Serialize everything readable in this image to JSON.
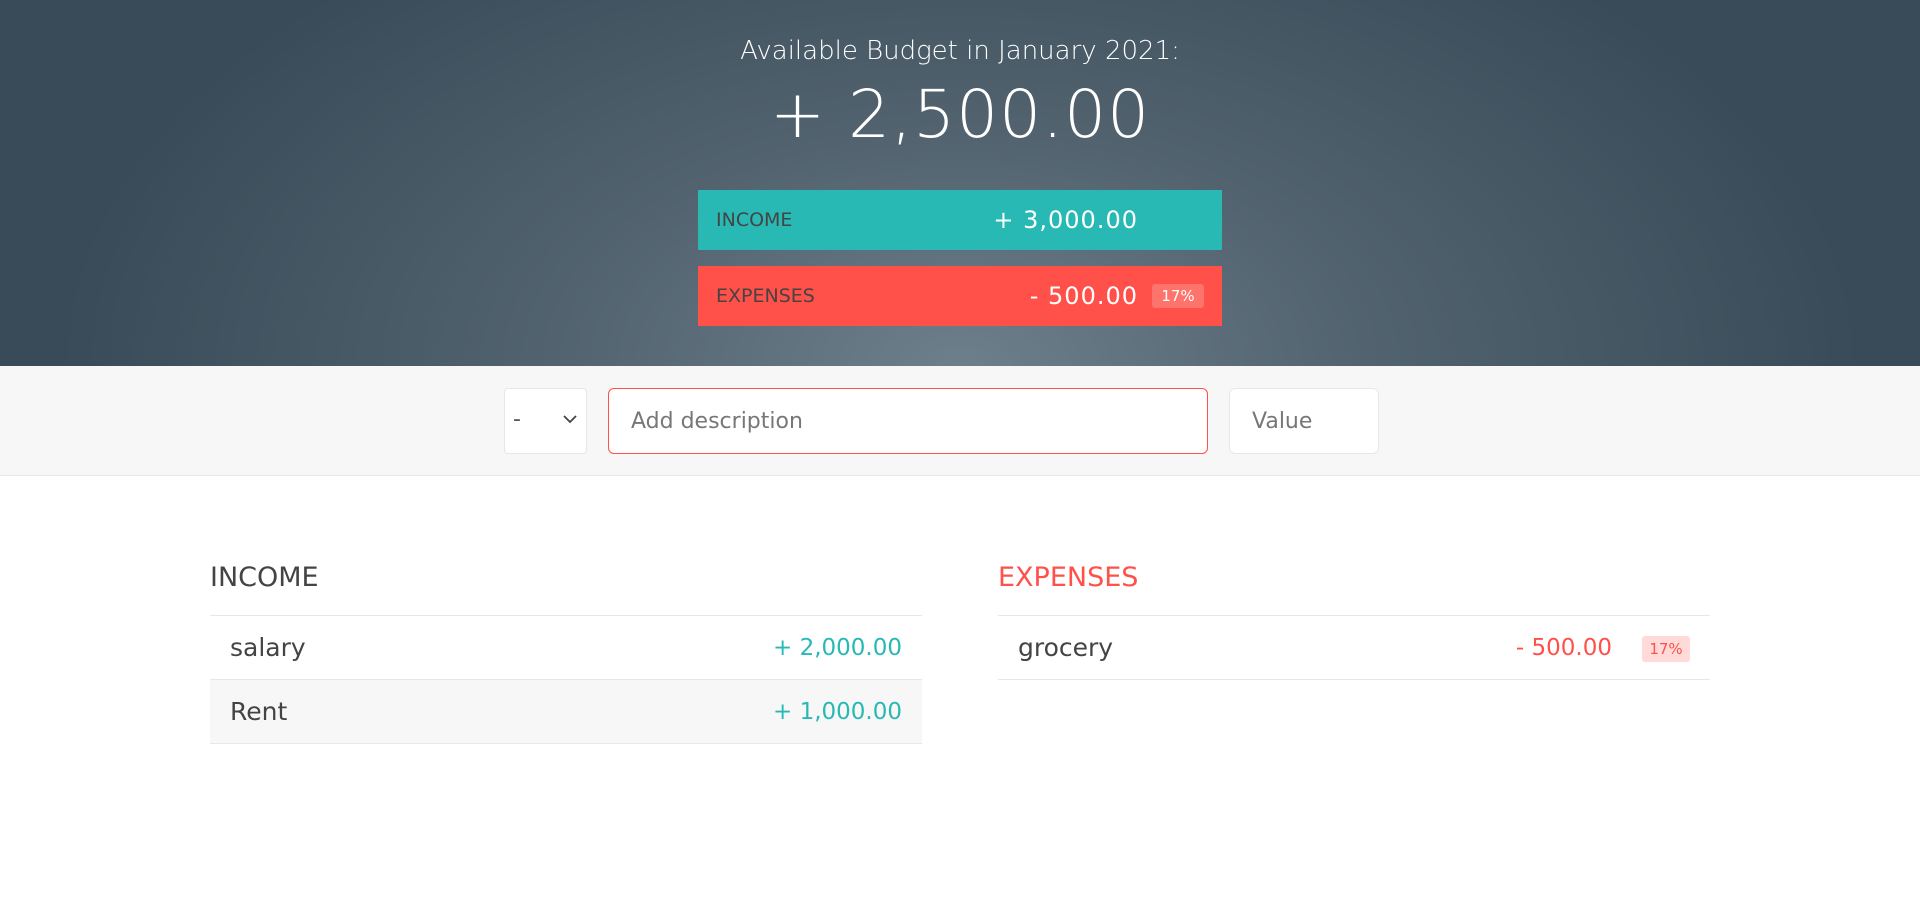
{
  "budget": {
    "title": "Available Budget in January 2021:",
    "value": "+ 2,500.00"
  },
  "summary": {
    "income": {
      "label": "Income",
      "value": "+ 3,000.00"
    },
    "expenses": {
      "label": "Expenses",
      "value": "- 500.00",
      "percentage": "17%"
    }
  },
  "add_form": {
    "type_select": {
      "selected": "-",
      "options": [
        "+",
        "-"
      ]
    },
    "description_placeholder": "Add description",
    "value_placeholder": "Value",
    "description_value": "",
    "value_value": ""
  },
  "income_list": {
    "title": "Income",
    "items": [
      {
        "description": "salary",
        "value": "+ 2,000.00"
      },
      {
        "description": "Rent",
        "value": "+ 1,000.00"
      }
    ]
  },
  "expenses_list": {
    "title": "Expenses",
    "items": [
      {
        "description": "grocery",
        "value": "- 500.00",
        "percentage": "17%"
      }
    ]
  },
  "colors": {
    "income": "#28b9b5",
    "expenses": "#ff5049"
  }
}
